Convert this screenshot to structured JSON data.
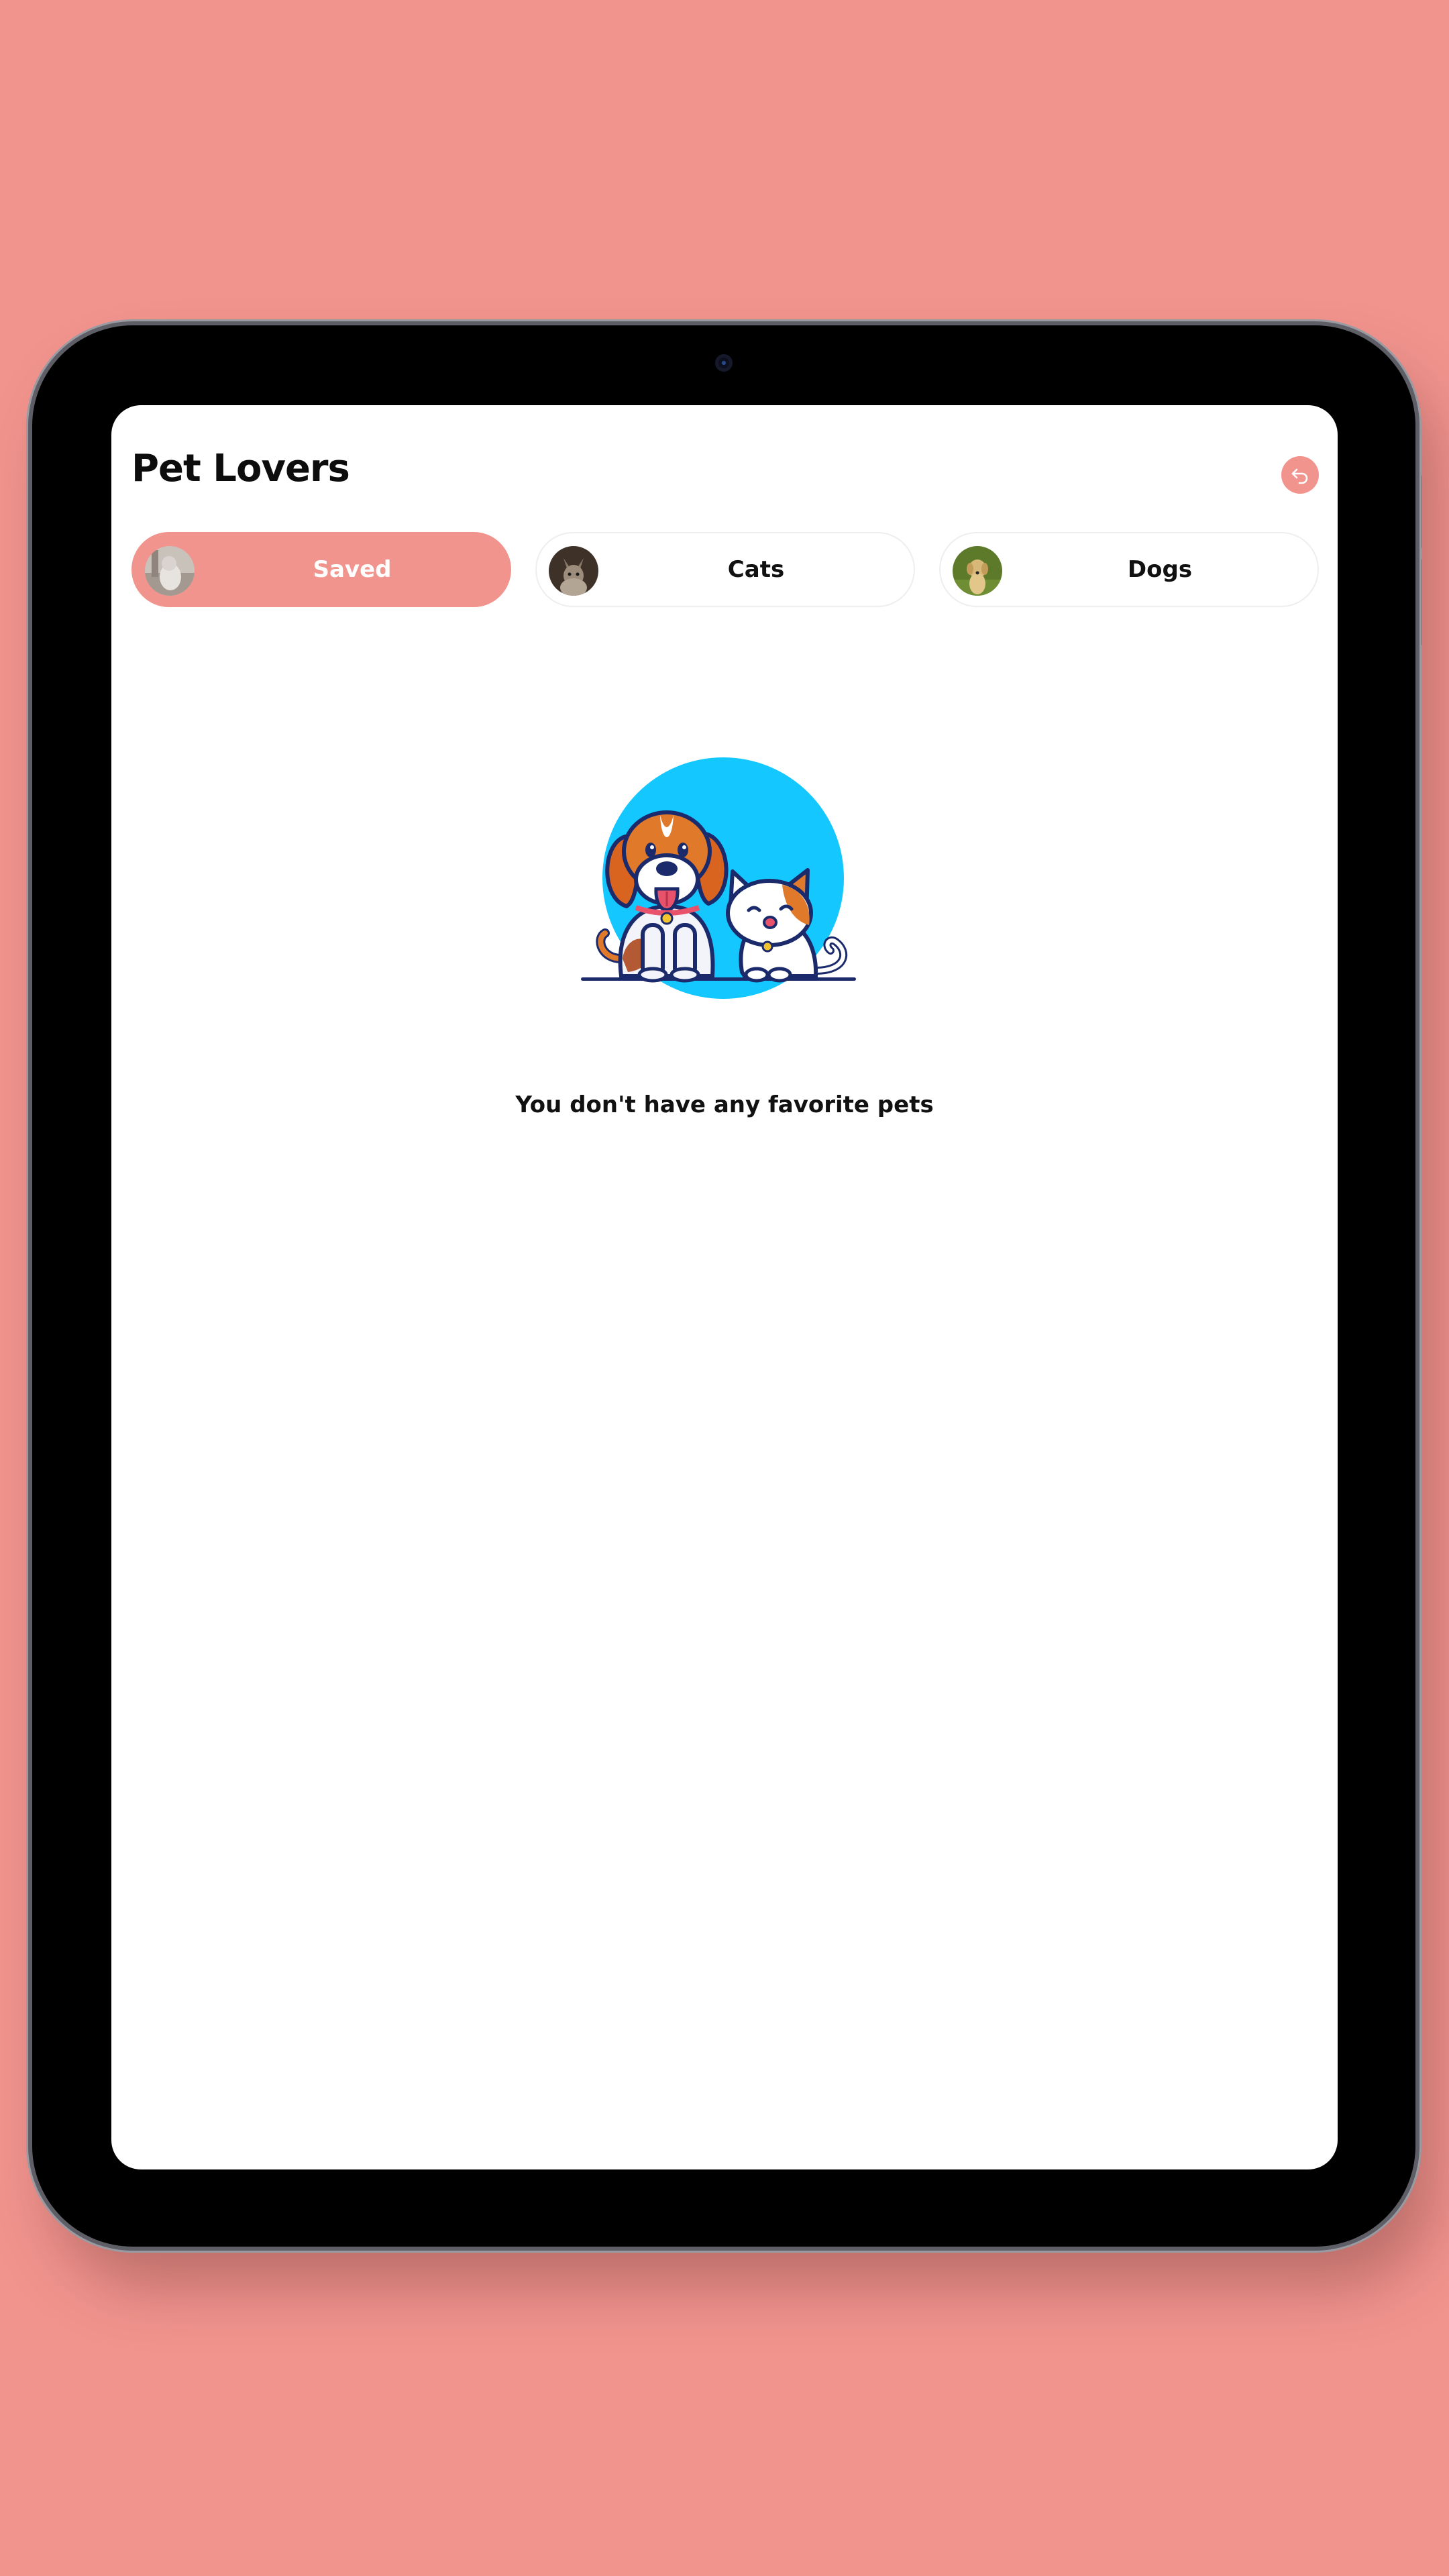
{
  "app": {
    "title": "Pet Lovers"
  },
  "header": {
    "back_icon": "back-arrow-icon"
  },
  "tabs": [
    {
      "label": "Saved",
      "active": true,
      "avatar": "saved-pet-avatar"
    },
    {
      "label": "Cats",
      "active": false,
      "avatar": "cat-avatar"
    },
    {
      "label": "Dogs",
      "active": false,
      "avatar": "dog-avatar"
    }
  ],
  "empty_state": {
    "message": "You don't have any favorite pets",
    "illustration": "dog-and-cat-illustration"
  },
  "colors": {
    "background": "#f2948e",
    "accent": "#f2948e",
    "illustration_circle": "#14c8ff"
  }
}
